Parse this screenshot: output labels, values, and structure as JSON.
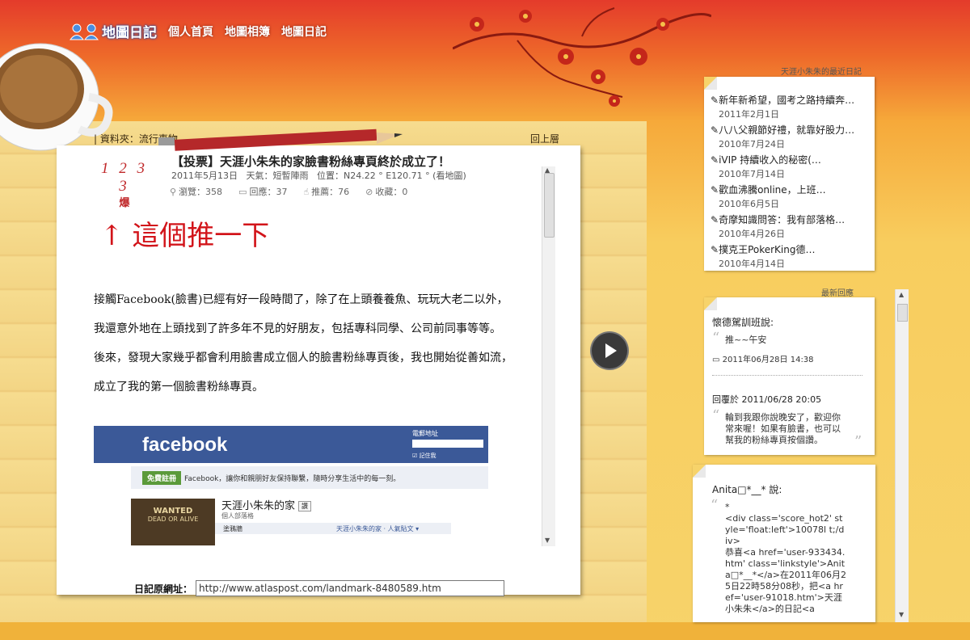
{
  "nav": {
    "logo": "地圖日記",
    "links": [
      "個人首頁",
      "地圖相簿",
      "地圖日記"
    ]
  },
  "folder": {
    "label": "| 資料夾：",
    "name": "流行事物",
    "back_top": "回上層"
  },
  "post": {
    "counter": "1 2 3 3",
    "hot": "爆",
    "title": "【投票】天涯小朱朱的家臉書粉絲專頁終於成立了！",
    "date": "2011年5月13日",
    "weather": "天氣：短暫陣雨",
    "location": "位置：N24.22 ° E120.71 °",
    "map_link": "(看地圖)",
    "views": "瀏覽：358",
    "replies": "回應：37",
    "recommends": "推薦：76",
    "favorites": "收藏：0",
    "push_text": "↑  這個推一下",
    "paragraphs": [
      "接觸Facebook(臉書)已經有好一段時間了，除了在上頭養養魚、玩玩大老二以外，",
      "我還意外地在上頭找到了許多年不見的好朋友，包括專科同學、公司前同事等等。",
      "後來，發現大家幾乎都會利用臉書成立個人的臉書粉絲專頁後，我也開始從善如流，",
      "成立了我的第一個臉書粉絲專頁。"
    ],
    "url_label": "日記原網址：",
    "url_value": "http://www.atlaspost.com/landmark-8480589.htm"
  },
  "fb": {
    "logo": "facebook",
    "email_label": "電郵地址",
    "remember": "記住我",
    "signup": "免費註冊",
    "tagline": "Facebook，讓你和親朋好友保持聯繫，隨時分享生活中的每一刻。",
    "wanted": "WANTED",
    "wanted_sub": "DEAD OR ALIVE",
    "page_name": "天涯小朱朱的家",
    "like": "讚",
    "page_type": "個人部落格",
    "row_left": "塗鴉牆",
    "row_right": "天涯小朱朱的家 · 人氣貼文 ▾"
  },
  "recent": {
    "title": "天涯小朱朱的最近日記",
    "items": [
      {
        "title": "新年新希望，國考之路持續奔…",
        "date": "2011年2月1日"
      },
      {
        "title": "八八父親節好禮，就靠好股力…",
        "date": "2010年7月24日"
      },
      {
        "title": "iVIP 持續收入的秘密(…",
        "date": "2010年7月14日"
      },
      {
        "title": "歡血沸騰online，上班…",
        "date": "2010年6月5日"
      },
      {
        "title": "奇摩知識問答：我有部落格…",
        "date": "2010年4月26日"
      },
      {
        "title": "撲克王PokerKing德…",
        "date": "2010年4月14日"
      }
    ]
  },
  "comments": {
    "title": "最新回應",
    "c1_author": "懷德駕訓班說:",
    "c1_text": "推~~午安",
    "c1_time": "2011年06月28日 14:38",
    "c1_reply_label": "回覆於 2011/06/28 20:05",
    "c1_reply": "輪到我跟你說晚安了，歡迎你常來喔！如果有臉書，也可以幫我的粉絲專頁按個讚。",
    "c2_author": "Anita□*__* 說:",
    "c2_text": "*\n<div class='score_hot2' style='float:left'>10078l t;/div>\n恭喜<a href='user-933434.htm' class='linkstyle'>Anita□*__*</a>在2011年06月25日22時58分08秒，把<a href='user-91018.htm'>天涯小朱朱</a>的日記<a"
  }
}
